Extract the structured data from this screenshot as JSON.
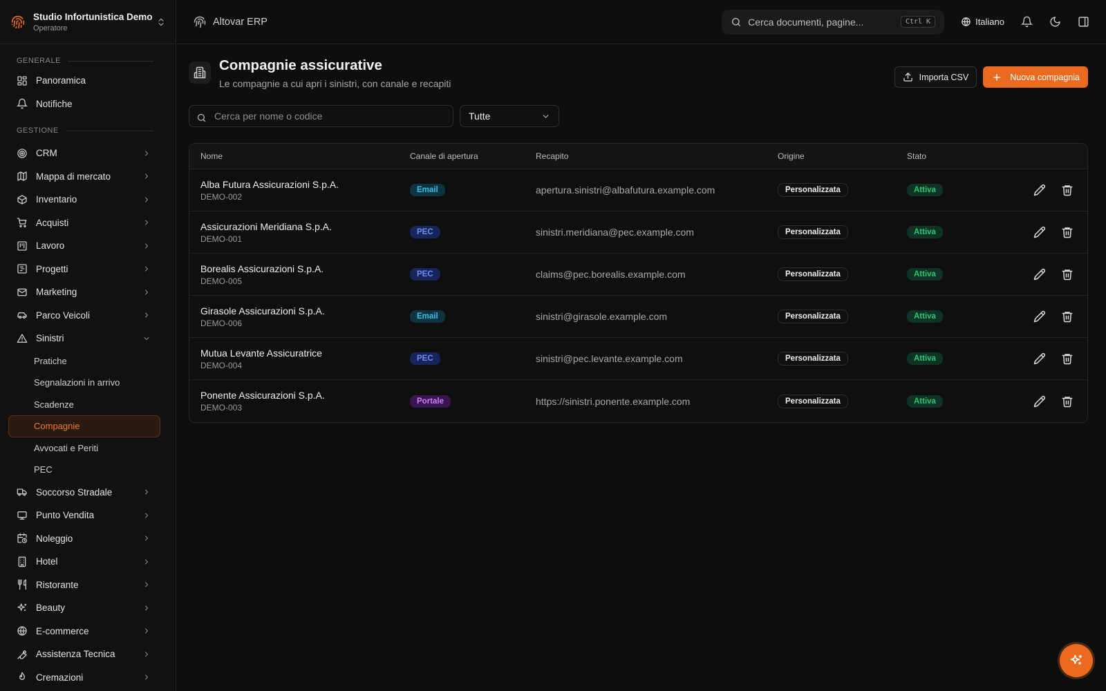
{
  "org": {
    "name": "Studio Infortunistica Demo",
    "role": "Operatore"
  },
  "sidebar": {
    "section_generale": "GENERALE",
    "section_gestione": "GESTIONE",
    "generale": [
      {
        "label": "Panoramica",
        "icon": "dashboard-icon"
      },
      {
        "label": "Notifiche",
        "icon": "bell-icon"
      }
    ],
    "gestione_top": [
      {
        "label": "CRM",
        "icon": "target-icon"
      },
      {
        "label": "Mappa di mercato",
        "icon": "map-icon"
      },
      {
        "label": "Inventario",
        "icon": "package-icon"
      },
      {
        "label": "Acquisti",
        "icon": "cart-icon"
      },
      {
        "label": "Lavoro",
        "icon": "kanban-icon"
      },
      {
        "label": "Progetti",
        "icon": "gantt-icon"
      },
      {
        "label": "Marketing",
        "icon": "mail-icon"
      },
      {
        "label": "Parco Veicoli",
        "icon": "car-icon"
      }
    ],
    "sinistri": {
      "label": "Sinistri",
      "icon": "warning-triangle-icon",
      "children": [
        "Pratiche",
        "Segnalazioni in arrivo",
        "Scadenze",
        "Compagnie",
        "Avvocati e Periti",
        "PEC"
      ],
      "active": "Compagnie"
    },
    "gestione_bottom": [
      {
        "label": "Soccorso Stradale",
        "icon": "truck-icon"
      },
      {
        "label": "Punto Vendita",
        "icon": "monitor-icon"
      },
      {
        "label": "Noleggio",
        "icon": "calendar-clock-icon"
      },
      {
        "label": "Hotel",
        "icon": "building-icon"
      },
      {
        "label": "Ristorante",
        "icon": "utensils-icon"
      },
      {
        "label": "Beauty",
        "icon": "sparkles-icon"
      },
      {
        "label": "E-commerce",
        "icon": "globe-icon"
      },
      {
        "label": "Assistenza Tecnica",
        "icon": "wrench-icon"
      },
      {
        "label": "Cremazioni",
        "icon": "flame-icon"
      }
    ]
  },
  "topbar": {
    "brand": "Altovar ERP",
    "search_placeholder": "Cerca documenti, pagine...",
    "shortcut": "Ctrl K",
    "language": "Italiano"
  },
  "page": {
    "title": "Compagnie assicurative",
    "subtitle": "Le compagnie a cui apri i sinistri, con canale e recapiti",
    "import_label": "Importa CSV",
    "new_label": "Nuova compagnia",
    "search_placeholder": "Cerca per nome o codice",
    "filter_value": "Tutte"
  },
  "table": {
    "columns": [
      "Nome",
      "Canale di apertura",
      "Recapito",
      "Origine",
      "Stato"
    ],
    "rows": [
      {
        "name": "Alba Futura Assicurazioni S.p.A.",
        "code": "DEMO-002",
        "channel": "Email",
        "contact": "apertura.sinistri@albafutura.example.com",
        "origin": "Personalizzata",
        "status": "Attiva"
      },
      {
        "name": "Assicurazioni Meridiana S.p.A.",
        "code": "DEMO-001",
        "channel": "PEC",
        "contact": "sinistri.meridiana@pec.example.com",
        "origin": "Personalizzata",
        "status": "Attiva"
      },
      {
        "name": "Borealis Assicurazioni S.p.A.",
        "code": "DEMO-005",
        "channel": "PEC",
        "contact": "claims@pec.borealis.example.com",
        "origin": "Personalizzata",
        "status": "Attiva"
      },
      {
        "name": "Girasole Assicurazioni S.p.A.",
        "code": "DEMO-006",
        "channel": "Email",
        "contact": "sinistri@girasole.example.com",
        "origin": "Personalizzata",
        "status": "Attiva"
      },
      {
        "name": "Mutua Levante Assicuratrice",
        "code": "DEMO-004",
        "channel": "PEC",
        "contact": "sinistri@pec.levante.example.com",
        "origin": "Personalizzata",
        "status": "Attiva"
      },
      {
        "name": "Ponente Assicurazioni S.p.A.",
        "code": "DEMO-003",
        "channel": "Portale",
        "contact": "https://sinistri.ponente.example.com",
        "origin": "Personalizzata",
        "status": "Attiva"
      }
    ]
  },
  "colors": {
    "accent": "#ea6a1f",
    "email": "#36c2e6",
    "pec": "#6d8cf5",
    "portale": "#cd7ff3",
    "active": "#2cc776"
  }
}
